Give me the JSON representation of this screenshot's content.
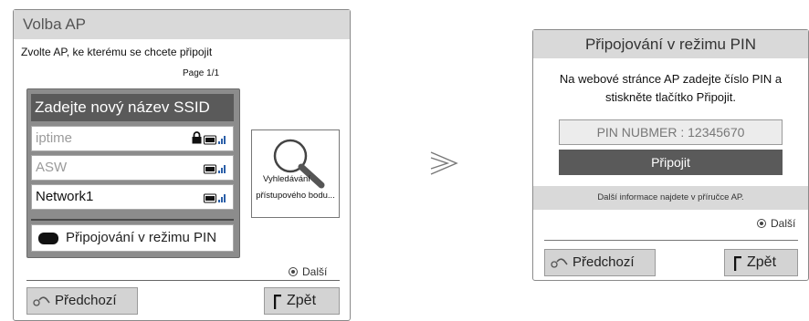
{
  "left": {
    "title": "Volba AP",
    "instruction": "Zvolte AP, ke kterému se chcete připojit",
    "page": "Page 1/1",
    "new_ssid": "Zadejte nový název SSID",
    "networks": [
      {
        "name": "iptime",
        "locked": true
      },
      {
        "name": "ASW",
        "locked": false
      },
      {
        "name": "Network1",
        "locked": false
      }
    ],
    "pin_mode_label": "Připojování v režimu PIN",
    "search_label_1": "Vyhledávání",
    "search_label_2": "přístupového bodu...",
    "next_label": "Další",
    "prev_label": "Předchozí",
    "back_label": "Zpět"
  },
  "right": {
    "title": "Připojování v režimu PIN",
    "message": "Na webové stránce AP zadejte číslo PIN a stiskněte tlačítko Připojit.",
    "pin_field": "PIN NUBMER : 12345670",
    "connect_label": "Připojit",
    "info": "Další informace najdete v příručce AP.",
    "next_label": "Další",
    "prev_label": "Předchozí",
    "back_label": "Zpět"
  },
  "icons": {
    "lock": "lock-icon",
    "signal": "signal-strength-icon",
    "search": "magnifier-icon",
    "arrow": "double-chevron-right-icon",
    "prev": "prev-remote-icon",
    "back": "back-key-icon",
    "dot": "radio-dot-icon",
    "red_key": "black-key-icon"
  },
  "colors": {
    "title_bar": "#d9d9d9",
    "selected": "#5a5a5a",
    "list_bg": "#8c8c8c",
    "footer_button": "#d3d3d3"
  }
}
